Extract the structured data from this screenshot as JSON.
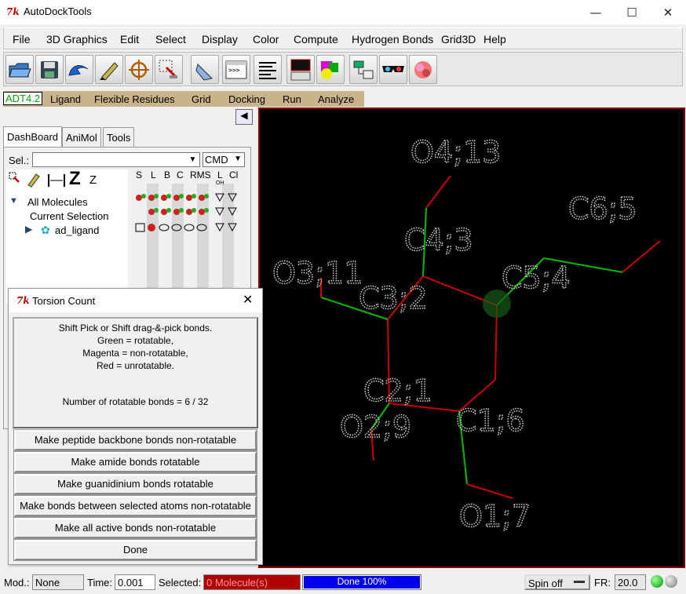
{
  "window": {
    "title": "AutoDockTools",
    "minimize_glyph": "—",
    "maximize_glyph": "☐",
    "close_glyph": "✕"
  },
  "menubar": {
    "items": [
      "File",
      "3D Graphics",
      "Edit",
      "Select",
      "Display",
      "Color",
      "Compute",
      "Hydrogen Bonds",
      "Grid3D",
      "Help"
    ]
  },
  "toolbar": {
    "icons": [
      "open-file-icon",
      "save-icon",
      "undo-icon",
      "pencil-icon",
      "crosshair-icon",
      "pick-select-icon",
      "hand-icon",
      "python-shell-icon",
      "text-lines-icon",
      "monitor-icon",
      "cpk-shapes-icon",
      "grid-table-icon",
      "stereo-glasses-icon",
      "cloud-surface-icon"
    ]
  },
  "adt_tabs": [
    "ADT4.2",
    "Ligand",
    "Flexible Residues",
    "Grid",
    "Docking",
    "Run",
    "Analyze"
  ],
  "notebook_tabs": [
    "DashBoard",
    "AniMol",
    "Tools"
  ],
  "dashboard": {
    "sel_label": "Sel.:",
    "sel_value": "",
    "cmd_label": "CMD",
    "tree_items": [
      "All Molecules",
      "Current Selection",
      "ad_ligand"
    ],
    "col_headers": [
      "S",
      "L",
      "B",
      "C",
      "RMS",
      "L",
      "Cl"
    ],
    "col_subheaders": [
      "OH"
    ],
    "z_big": "Z",
    "z_small": "Z"
  },
  "viewer": {
    "atom_labels": [
      "O4;13",
      "C6;5",
      "C4;3",
      "O3;11",
      "C5;4",
      "C3;2",
      "C2;1",
      "O2;9",
      "C1;6",
      "O1;7"
    ],
    "colors": {
      "rotatable": "#00cc00",
      "unrotatable": "#cc0000",
      "label": "#cfcfcf",
      "background": "#000000"
    }
  },
  "dialog": {
    "title": "Torsion Count",
    "close": "✕",
    "lines": [
      "Shift Pick or Shift drag-&-pick bonds.",
      "Green = rotatable,",
      "Magenta = non-rotatable,",
      "Red = unrotatable."
    ],
    "count_text": "Number of rotatable bonds = 6 / 32",
    "buttons": [
      "Make peptide backbone bonds non-rotatable",
      "Make amide bonds rotatable",
      "Make guanidinium bonds rotatable",
      "Make bonds between selected atoms non-rotatable",
      "Make all active bonds non-rotatable",
      "Done"
    ]
  },
  "statusbar": {
    "mod_label": "Mod.:",
    "mod_value": "None",
    "time_label": "Time:",
    "time_value": "0.001",
    "selected_label": "Selected:",
    "selected_value": "0 Molecule(s)",
    "progress_text": "Done 100%",
    "progress": 1.0,
    "spin_value": "Spin off",
    "fr_label": "FR:",
    "fr_value": "20.0"
  }
}
